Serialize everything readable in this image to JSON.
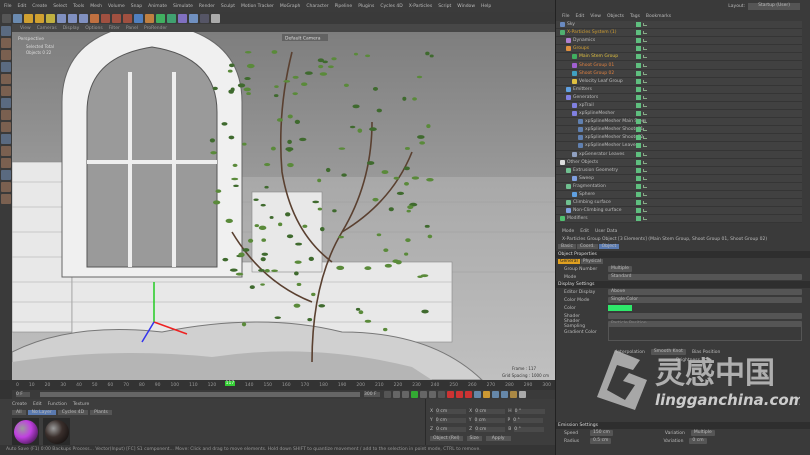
{
  "menubar": [
    "File",
    "Edit",
    "Create",
    "Select",
    "Tools",
    "Mesh",
    "Volume",
    "Snap",
    "Animate",
    "Simulate",
    "Render",
    "Sculpt",
    "Motion Tracker",
    "MoGraph",
    "Character",
    "Pipeline",
    "Plugins",
    "Cycles 4D",
    "X-Particles",
    "Script",
    "Window",
    "Help"
  ],
  "viewport": {
    "menu": [
      "View",
      "Cameras",
      "Display",
      "Options",
      "Filter",
      "Panel",
      "ProRender"
    ],
    "hud_title": "Perspective",
    "hud_selected": "Selected Total",
    "hud_objects": "Objects  0  22",
    "camera_label": "Default Camera",
    "frame_label": "Frame : 117",
    "grid_spacing": "Grid Spacing : 1000 cm"
  },
  "timeline": {
    "ticks": [
      "0",
      "10",
      "20",
      "30",
      "40",
      "50",
      "60",
      "70",
      "80",
      "90",
      "100",
      "110",
      "120",
      "130",
      "140",
      "150",
      "160",
      "170",
      "180",
      "190",
      "200",
      "210",
      "220",
      "230",
      "240",
      "250",
      "260",
      "270",
      "280",
      "290",
      "300"
    ],
    "current": "117",
    "start": "0 F",
    "end": "300 F"
  },
  "material_manager": {
    "menu": [
      "Create",
      "Edit",
      "Function",
      "Texture"
    ],
    "filters": [
      "All",
      "No Layer",
      "Cycles 4D",
      "Plants"
    ],
    "materials": [
      {
        "name": "Mat",
        "color": "#c040e0"
      },
      {
        "name": "Mat",
        "color": "#3a2f2c"
      }
    ]
  },
  "coordinates": {
    "rows": [
      [
        "X",
        "0 cm",
        "X",
        "0 cm",
        "H",
        "0 °"
      ],
      [
        "Y",
        "0 cm",
        "Y",
        "0 cm",
        "P",
        "0 °"
      ],
      [
        "Z",
        "0 cm",
        "Z",
        "0 cm",
        "B",
        "0 °"
      ]
    ],
    "mode": "Object (Rel)",
    "size": "Size",
    "apply": "Apply"
  },
  "status": "Auto Save (F1) 0:00 Backups Process... Vector(Input) [FC] S1 component... Move: Click and drag to move elements. Hold down SHIFT to quantize movement / add to the selection in point mode, CTRL to remove.",
  "layout": {
    "label": "Layout:",
    "value": "Startup (User)"
  },
  "object_manager": {
    "menu": [
      "File",
      "Edit",
      "View",
      "Objects",
      "Tags",
      "Bookmarks"
    ],
    "objects": [
      {
        "name": "Sky",
        "depth": 0,
        "color": "#bbb",
        "icon": "#6a8ac0"
      },
      {
        "name": "X-Particles System (1)",
        "depth": 0,
        "color": "#d4a030",
        "icon": "#50b070"
      },
      {
        "name": "Dynamics",
        "depth": 1,
        "color": "#bbb",
        "icon": "#b080d0"
      },
      {
        "name": "Groups",
        "depth": 1,
        "color": "#d4a030",
        "icon": "#e09040"
      },
      {
        "name": "Main Stem Group",
        "depth": 2,
        "color": "#e0c040",
        "icon": "#40b060"
      },
      {
        "name": "Shoot Group 01",
        "depth": 2,
        "color": "#e08040",
        "icon": "#a060d0"
      },
      {
        "name": "Shoot Group 02",
        "depth": 2,
        "color": "#e08040",
        "icon": "#40a0c0"
      },
      {
        "name": "Velocity Leaf Group",
        "depth": 2,
        "color": "#bbb",
        "icon": "#e0c040"
      },
      {
        "name": "Emitters",
        "depth": 1,
        "color": "#bbb",
        "icon": "#60a0e0"
      },
      {
        "name": "Generators",
        "depth": 1,
        "color": "#bbb",
        "icon": "#8080e0"
      },
      {
        "name": "xpTrail",
        "depth": 2,
        "color": "#bbb",
        "icon": "#8080e0"
      },
      {
        "name": "xpSplineMesher",
        "depth": 2,
        "color": "#bbb",
        "icon": "#8080e0"
      },
      {
        "name": "xpSplineMesher Main Stem",
        "depth": 3,
        "color": "#bbb",
        "icon": "#6080b0"
      },
      {
        "name": "xpSplineMesher Shoots01",
        "depth": 3,
        "color": "#bbb",
        "icon": "#6080b0"
      },
      {
        "name": "xpSplineMesher Shoots02",
        "depth": 3,
        "color": "#bbb",
        "icon": "#6080b0"
      },
      {
        "name": "xpSplineMesher Leaves",
        "depth": 3,
        "color": "#bbb",
        "icon": "#6080b0"
      },
      {
        "name": "xpGenerator Leaves",
        "depth": 2,
        "color": "#bbb",
        "icon": "#90a0c0"
      },
      {
        "name": "Other Objects",
        "depth": 0,
        "color": "#bbb",
        "icon": "#ddd"
      },
      {
        "name": "Extrusion Geometry",
        "depth": 1,
        "color": "#bbb",
        "icon": "#70c090"
      },
      {
        "name": "Sweep",
        "depth": 2,
        "color": "#bbb",
        "icon": "#80a0e0"
      },
      {
        "name": "Fragmentation",
        "depth": 1,
        "color": "#bbb",
        "icon": "#70c090"
      },
      {
        "name": "Sphere",
        "depth": 2,
        "color": "#bbb",
        "icon": "#60a0e0"
      },
      {
        "name": "Climbing surface",
        "depth": 1,
        "color": "#bbb",
        "icon": "#70c090"
      },
      {
        "name": "Non-Climbing surface",
        "depth": 1,
        "color": "#bbb",
        "icon": "#80a0e0"
      },
      {
        "name": "Modifiers",
        "depth": 0,
        "color": "#bbb",
        "icon": "#50c070"
      }
    ]
  },
  "attributes": {
    "menu": [
      "Mode",
      "Edit",
      "User Data"
    ],
    "title": "X-Particles Group Object [3 Elements] (Main Stem Group, Shoot Group 01, Shoot Group 02)",
    "tabs": [
      "Basic",
      "Coord.",
      "Object"
    ],
    "section1": "Object Properties",
    "subtabs": [
      "General",
      "Physical"
    ],
    "group_number_label": "Group Number",
    "group_number": "Multiple",
    "mode_label": "Mode",
    "mode": "Standard",
    "section2": "Display Settings",
    "editor_display_label": "Editor Display",
    "editor_display": "Above",
    "color_mode_label": "Color Mode",
    "color_mode": "Single Color",
    "color_label": "Color",
    "color": "#2ee86a",
    "shader_label": "Shader",
    "shader_sampling_label": "Shader Sampling",
    "shader_sampling": "Particle Position",
    "gradient_label": "Gradient Color",
    "interpolation_label": "Interpolation",
    "interpolation": "Smooth Knot",
    "bias_label": "Bias Position",
    "brightness_label": "Brightness",
    "section3": "Emission Settings",
    "speed_label": "Speed",
    "speed": "150 cm",
    "radius_label": "Radius",
    "radius": "0.5 cm",
    "variation_label": "Variation",
    "variation": "Multiple",
    "variation2": "0 cm"
  },
  "watermark": {
    "chinese": "灵感中国",
    "latin": "lingganchina.com"
  }
}
